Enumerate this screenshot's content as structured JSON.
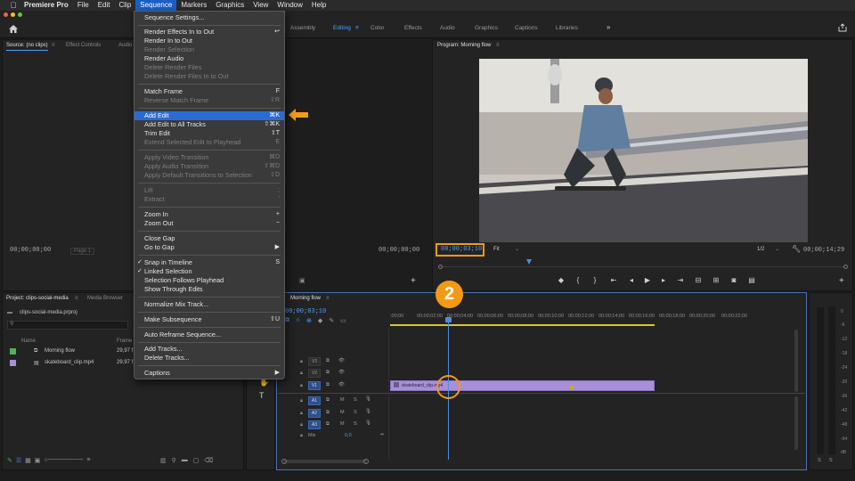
{
  "menubar": {
    "apple": "",
    "items": [
      "Premiere Pro",
      "File",
      "Edit",
      "Clip",
      "Sequence",
      "Markers",
      "Graphics",
      "View",
      "Window",
      "Help"
    ],
    "active_index": 4
  },
  "workspaces": {
    "items": [
      "Assembly",
      "Editing",
      "Color",
      "Effects",
      "Audio",
      "Graphics",
      "Captions",
      "Libraries"
    ],
    "active": "Editing",
    "more": "»"
  },
  "source_panel": {
    "tab_source": "Source: (no clips)",
    "tab_effect_controls": "Effect Controls",
    "tab_audio": "Audio",
    "timecode_left": "00;00;00;00",
    "page": "Page 1",
    "timecode_right": "00;00;00;00"
  },
  "program_panel": {
    "title": "Program: Morning flow",
    "timecode": "00;00;03;10",
    "fit": "Fit",
    "ratio": "1/2",
    "duration": "00;00;14;29"
  },
  "sequence_menu": {
    "items": [
      {
        "label": "Sequence Settings...",
        "shortcut": "",
        "disabled": false
      },
      {
        "label": "Render Effects In to Out",
        "shortcut": "↩",
        "disabled": false
      },
      {
        "label": "Render In to Out",
        "shortcut": "",
        "disabled": false
      },
      {
        "label": "Render Selection",
        "shortcut": "",
        "disabled": true
      },
      {
        "label": "Render Audio",
        "shortcut": "",
        "disabled": false
      },
      {
        "label": "Delete Render Files",
        "shortcut": "",
        "disabled": true
      },
      {
        "label": "Delete Render Files In to Out",
        "shortcut": "",
        "disabled": true
      },
      {
        "label": "Match Frame",
        "shortcut": "F",
        "disabled": false
      },
      {
        "label": "Reverse Match Frame",
        "shortcut": "⇧R",
        "disabled": true
      },
      {
        "label": "Add Edit",
        "shortcut": "⌘K",
        "disabled": false,
        "highlighted": true
      },
      {
        "label": "Add Edit to All Tracks",
        "shortcut": "⇧⌘K",
        "disabled": false
      },
      {
        "label": "Trim Edit",
        "shortcut": "⇧T",
        "disabled": false
      },
      {
        "label": "Extend Selected Edit to Playhead",
        "shortcut": "E",
        "disabled": true
      },
      {
        "label": "Apply Video Transition",
        "shortcut": "⌘D",
        "disabled": true
      },
      {
        "label": "Apply Audio Transition",
        "shortcut": "⇧⌘D",
        "disabled": true
      },
      {
        "label": "Apply Default Transitions to Selection",
        "shortcut": "⇧D",
        "disabled": true
      },
      {
        "label": "Lift",
        "shortcut": ";",
        "disabled": true
      },
      {
        "label": "Extract",
        "shortcut": "'",
        "disabled": true
      },
      {
        "label": "Zoom In",
        "shortcut": "+",
        "disabled": false
      },
      {
        "label": "Zoom Out",
        "shortcut": "−",
        "disabled": false
      },
      {
        "label": "Close Gap",
        "shortcut": "",
        "disabled": false
      },
      {
        "label": "Go to Gap",
        "shortcut": "▶",
        "disabled": false
      },
      {
        "label": "Snap in Timeline",
        "shortcut": "S",
        "disabled": false,
        "checked": true
      },
      {
        "label": "Linked Selection",
        "shortcut": "",
        "disabled": false,
        "checked": true
      },
      {
        "label": "Selection Follows Playhead",
        "shortcut": "",
        "disabled": false
      },
      {
        "label": "Show Through Edits",
        "shortcut": "",
        "disabled": false
      },
      {
        "label": "Normalize Mix Track...",
        "shortcut": "",
        "disabled": false
      },
      {
        "label": "Make Subsequence",
        "shortcut": "⇧U",
        "disabled": false
      },
      {
        "label": "Auto Reframe Sequence...",
        "shortcut": "",
        "disabled": false
      },
      {
        "label": "Add Tracks...",
        "shortcut": "",
        "disabled": false
      },
      {
        "label": "Delete Tracks...",
        "shortcut": "",
        "disabled": false
      },
      {
        "label": "Captions",
        "shortcut": "▶",
        "disabled": false
      }
    ]
  },
  "project_panel": {
    "tab_project": "Project: clips-social-media",
    "tab_media_browser": "Media Browser",
    "file": "clips-social-media.prproj",
    "col_name": "Name",
    "col_frame": "Frame",
    "rows": [
      {
        "name": "Morning flow",
        "frame_rate": "29,97 f",
        "color": "#4bb35a"
      },
      {
        "name": "skateboard_clip.mp4",
        "frame_rate": "29,97 f",
        "color": "#a88fd8"
      }
    ]
  },
  "timeline": {
    "title": "Morning flow",
    "timecode": "00;00;03;10",
    "ruler": [
      ";00;00",
      "00;00;02;00",
      "00;00;04;00",
      "00;00;06;00",
      "00;00;08;00",
      "00;00;10;00",
      "00;00;12;00",
      "00;00;14;00",
      "00;00;16;00",
      "00;00;18;00",
      "00;00;20;00",
      "00;00;22;00"
    ],
    "video_tracks": [
      "V3",
      "V2",
      "V1"
    ],
    "audio_tracks": [
      "A1",
      "A2",
      "A3"
    ],
    "mix_label": "Mix",
    "mix_value": "0,0",
    "clip_name": "skateboard_clip.mp4",
    "m": "M",
    "s": "S"
  },
  "annotations": {
    "step_number": "2"
  },
  "meter": {
    "labels": [
      "0",
      "-6",
      "-12",
      "-18",
      "-24",
      "-30",
      "-36",
      "-42",
      "-48",
      "-54",
      "dB"
    ],
    "solo": [
      "S",
      "S"
    ]
  },
  "colors": {
    "accent_blue": "#2c6bd4",
    "annotation_orange": "#f29a16",
    "clip_purple": "#a88fd8"
  }
}
